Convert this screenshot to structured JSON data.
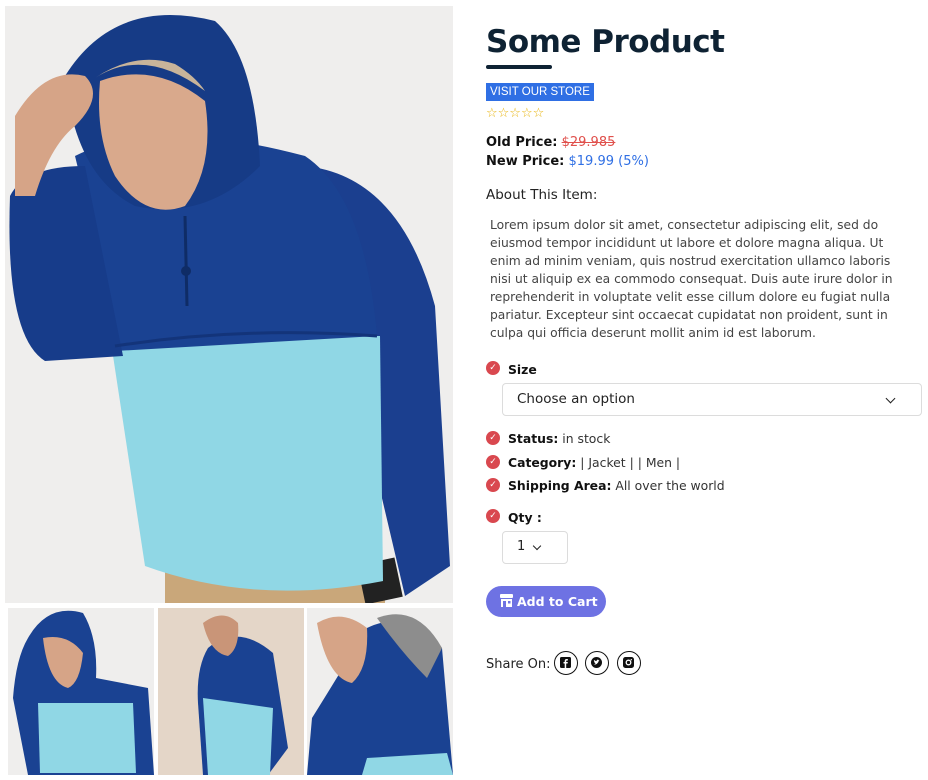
{
  "product": {
    "title": "Some Product",
    "store_link": "VISIT OUR STORE",
    "rating": 0,
    "rating_max": 5,
    "stars": "☆☆☆☆☆",
    "old_price_label": "Old Price:",
    "old_price_value": "$29.985",
    "new_price_label": "New Price:",
    "new_price_value": "$19.99 (5%)",
    "about_heading": "About This Item:",
    "description": "Lorem ipsum dolor sit amet, consectetur adipiscing elit, sed do eiusmod tempor incididunt ut labore et dolore magna aliqua. Ut enim ad minim veniam, quis nostrud exercitation ullamco laboris nisi ut aliquip ex ea commodo consequat. Duis aute irure dolor in reprehenderit in voluptate velit esse cillum dolore eu fugiat nulla pariatur. Excepteur sint occaecat cupidatat non proident, sunt in culpa qui officia deserunt mollit anim id est laborum."
  },
  "size": {
    "label": "Size",
    "selected": "Choose an option"
  },
  "details": {
    "status_label": "Status:",
    "status_value": "in stock",
    "category_label": "Category:",
    "category_value": "| Jacket | | Men |",
    "shipping_label": "Shipping Area:",
    "shipping_value": "All over the world"
  },
  "qty": {
    "label": "Qty :",
    "value": "1"
  },
  "cart": {
    "label": "Add to Cart"
  },
  "share": {
    "label": "Share On:",
    "networks": [
      "facebook-icon",
      "twitter-icon",
      "instagram-icon"
    ]
  },
  "colors": {
    "store_link_bg": "#2f6fe4",
    "old_price": "#e0504c",
    "new_price": "#2f6fe4",
    "check": "#d9484f",
    "cart_button": "#6e72e3",
    "star": "#e8b40f",
    "jacket_navy": "#173e8c",
    "jacket_cyan": "#8fd8e6"
  }
}
